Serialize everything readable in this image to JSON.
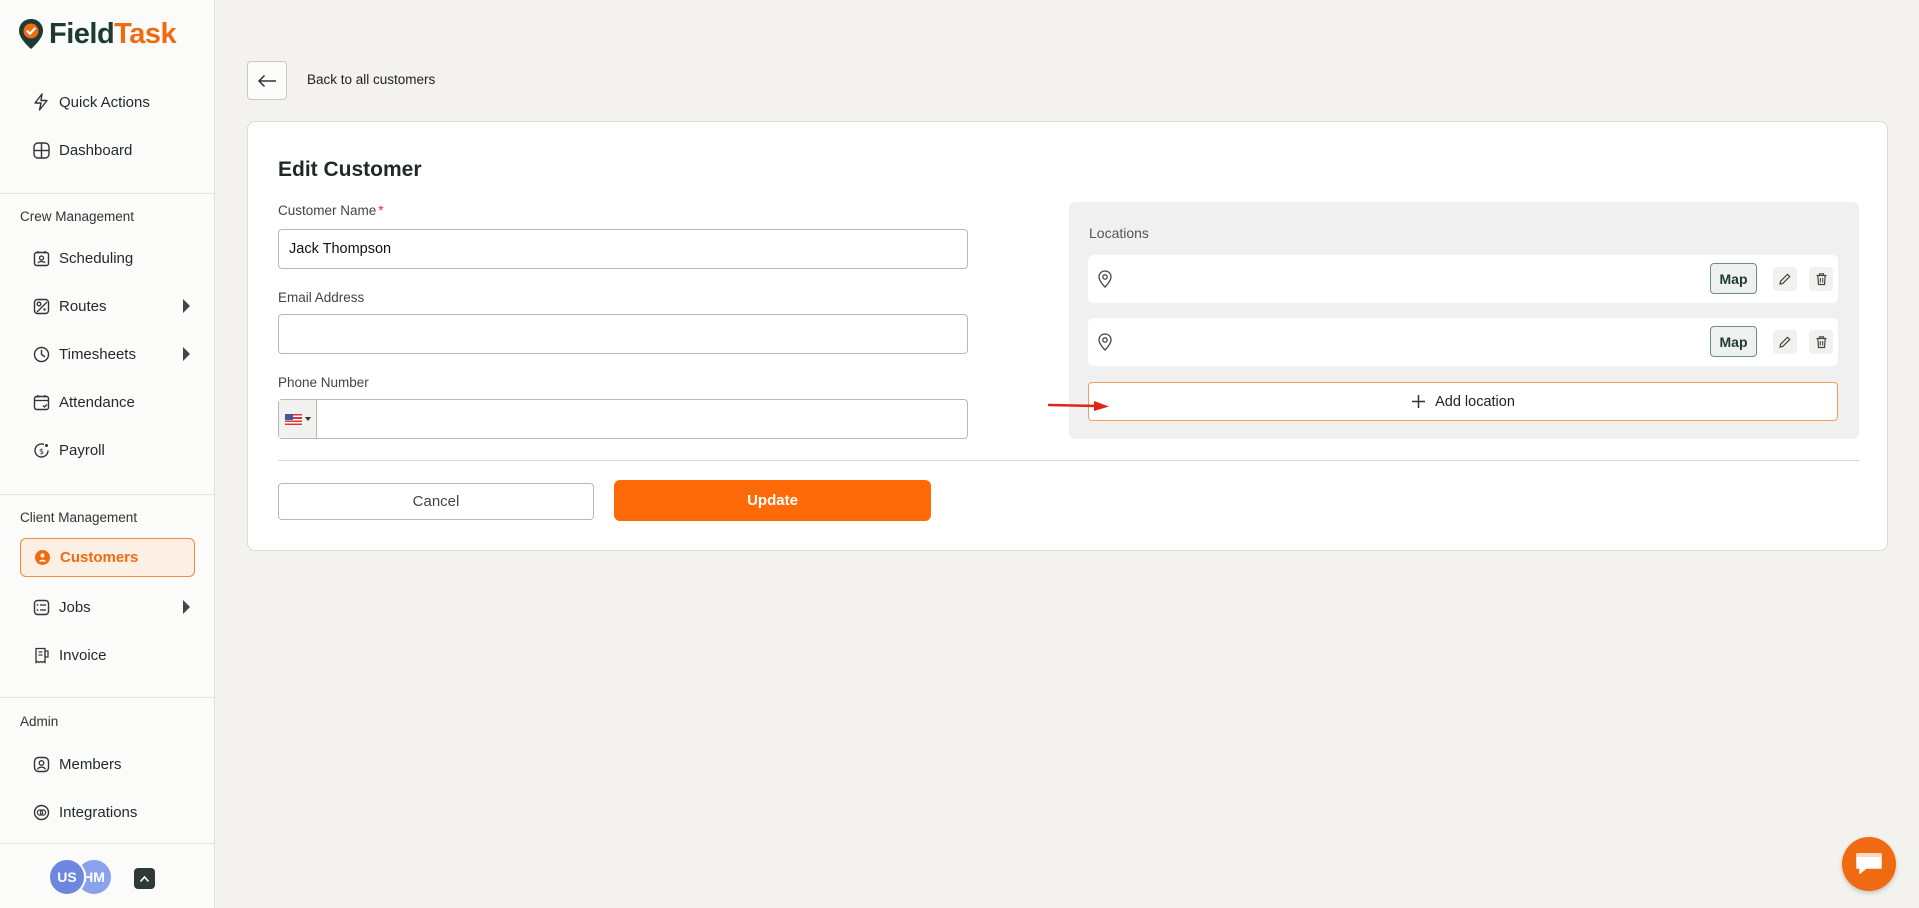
{
  "app": {
    "logo_part1": "Field",
    "logo_part2": "Task",
    "brand_color": "#f26a10"
  },
  "sidebar": {
    "top_items": [
      {
        "label": "Quick Actions",
        "icon": "bolt-icon"
      },
      {
        "label": "Dashboard",
        "icon": "dashboard-grid-icon"
      }
    ],
    "sections": [
      {
        "label": "Crew Management",
        "items": [
          {
            "label": "Scheduling",
            "icon": "calendar-person-icon"
          },
          {
            "label": "Routes",
            "icon": "route-map-icon",
            "expandable": true
          },
          {
            "label": "Timesheets",
            "icon": "clock-icon",
            "expandable": true
          },
          {
            "label": "Attendance",
            "icon": "calendar-check-icon"
          },
          {
            "label": "Payroll",
            "icon": "dollar-coin-icon"
          }
        ]
      },
      {
        "label": "Client Management",
        "items": [
          {
            "label": "Customers",
            "icon": "customer-icon",
            "active": true
          },
          {
            "label": "Jobs",
            "icon": "job-list-icon",
            "expandable": true
          },
          {
            "label": "Invoice",
            "icon": "invoice-icon"
          }
        ]
      },
      {
        "label": "Admin",
        "items": [
          {
            "label": "Members",
            "icon": "member-icon"
          },
          {
            "label": "Integrations",
            "icon": "integrations-icon"
          }
        ]
      }
    ],
    "user": {
      "avatar1": "US",
      "avatar2": "HM"
    }
  },
  "header": {
    "back_label": "Back to all customers"
  },
  "form": {
    "title": "Edit Customer",
    "customer_name_label": "Customer Name",
    "required_mark": "*",
    "customer_name_value": "Jack Thompson",
    "email_label": "Email Address",
    "email_value": "",
    "phone_label": "Phone Number",
    "phone_value": "",
    "phone_country": "US",
    "cancel_label": "Cancel",
    "update_label": "Update"
  },
  "locations": {
    "title": "Locations",
    "rows": [
      {
        "address": "",
        "map_label": "Map"
      },
      {
        "address": "",
        "map_label": "Map"
      }
    ],
    "add_label": "Add location"
  }
}
